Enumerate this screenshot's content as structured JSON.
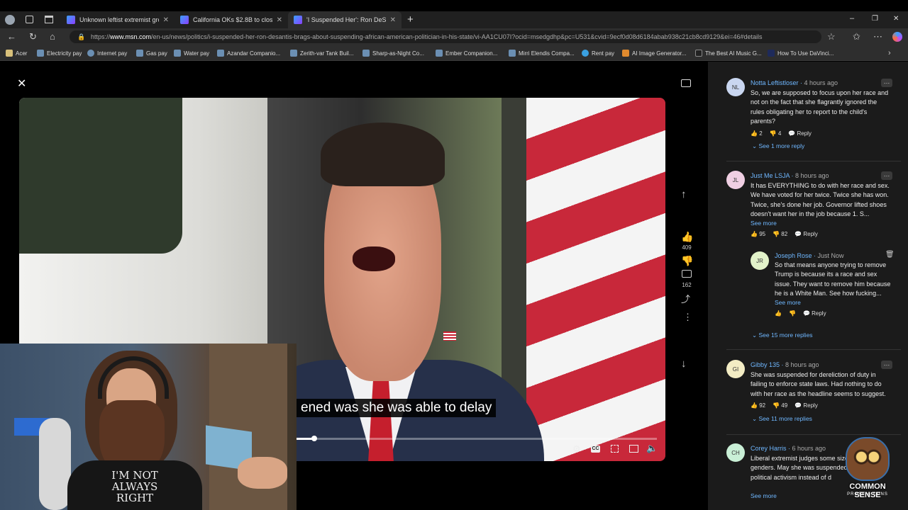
{
  "tabs": [
    {
      "title": "Unknown leftist extremist group ...",
      "close": "✕"
    },
    {
      "title": "California OKs $2.8B to close Me...",
      "close": "✕"
    },
    {
      "title": "'I Suspended Her': Ron DeSantis ...",
      "close": "✕"
    }
  ],
  "new_tab": "+",
  "window_controls": {
    "minimize": "–",
    "restore": "❐",
    "close": "✕"
  },
  "url": {
    "prefix": "https://",
    "host": "www.msn.com",
    "path": "/en-us/news/politics/i-suspended-her-ron-desantis-brags-about-suspending-african-american-politician-in-his-state/vi-AA1CU07I?ocid=msedgdhp&pc=U531&cvid=9ecf0d08d6184abab938c21cb8cd9129&ei=46#details"
  },
  "bookmarks": [
    "Acer",
    "Electricity pay",
    "Internet pay",
    "Gas pay",
    "Water pay",
    "Azandar Companio...",
    "Zerith-var Tank Buil...",
    "Sharp-as-Night Co...",
    "Ember Companion...",
    "Mirri Elendis Compa...",
    "Rent pay",
    "AI Image Generator...",
    "The Best AI Music G...",
    "How To Use DaVinci..."
  ],
  "player": {
    "close": "✕",
    "subtitle": "ened was she was able to delay",
    "like_count": "409",
    "comment_count": "162",
    "progress": 0.05
  },
  "overlay": {
    "badge_text": "I'M NOT ALWAYS RIGHT",
    "logo_line1": "COMMON SENSE",
    "logo_line2": "PROSE & CONS"
  },
  "comments": [
    {
      "initials": "NL",
      "avatar_color": "#c9d6f0",
      "author": "Notta Leftistloser",
      "time": "4 hours ago",
      "text": "So, we are supposed to focus upon her race and not on the fact that she flagrantly ignored the rules obligating her to report to the child's parents?",
      "likes": "2",
      "dislikes": "4",
      "reply": "Reply",
      "see_replies": "See 1 more reply"
    },
    {
      "initials": "JL",
      "avatar_color": "#f0cfe3",
      "author": "Just Me LSJA",
      "time": "8 hours ago",
      "text": "It has EVERYTHING to do with her race and sex. We have voted for her twice.  Twice she has won.  Twice, she's done her job.  Governor lifted shoes doesn't want her in the job because 1. S...",
      "see_more": "See more",
      "likes": "95",
      "dislikes": "82",
      "reply": "Reply"
    },
    {
      "initials": "JR",
      "avatar_color": "#e2f2c9",
      "author": "Joseph Rose",
      "time": "Just Now",
      "text": "So that means anyone trying to remove Trump is because its a race and sex issue. They want to remove him because he is a White Man. See how fucking...",
      "see_more": "See more",
      "reply": "Reply",
      "see_replies": "See 15 more replies"
    },
    {
      "initials": "GI",
      "avatar_color": "#f3ecc4",
      "author": "Gibby 135",
      "time": "8 hours ago",
      "text": "She was suspended for dereliction of duty in failing to enforce state laws. Had nothing to do with her race as the headline seems to suggest.",
      "likes": "92",
      "dislikes": "49",
      "reply": "Reply",
      "see_replies": "See 11 more replies"
    },
    {
      "initials": "CH",
      "avatar_color": "#c9efd6",
      "author": "Corey Harris",
      "time": "6 hours ago",
      "text": "Liberal extremist judges some sizes, colors and genders. May she was suspended for using political activism instead of d",
      "see_more": "See more"
    }
  ]
}
